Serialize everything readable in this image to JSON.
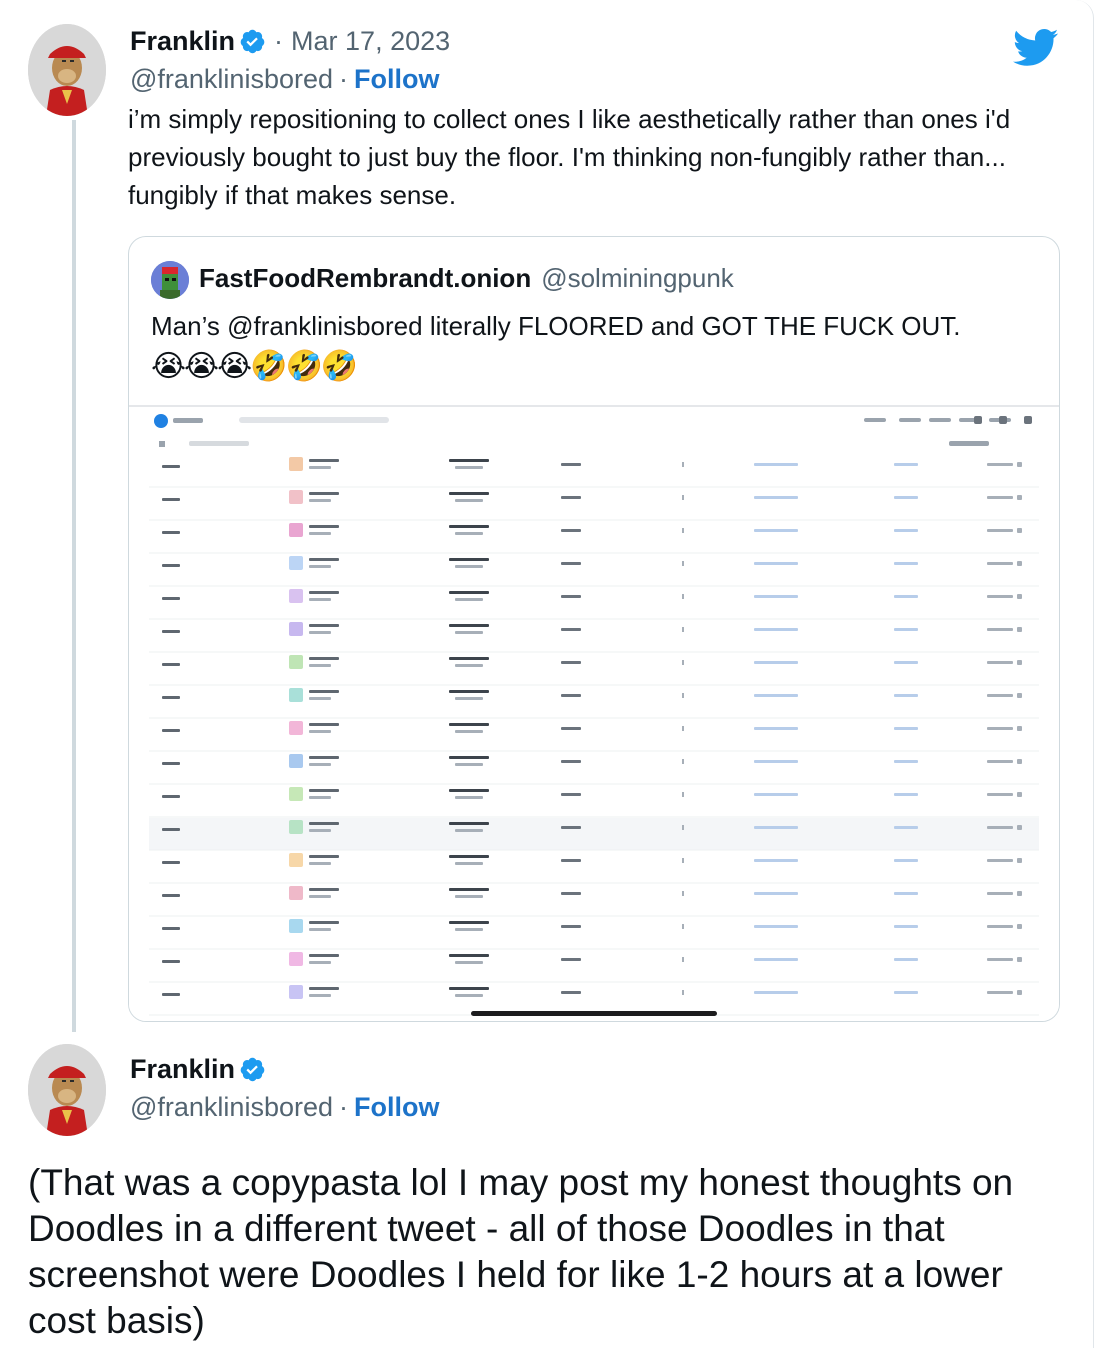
{
  "tweet1": {
    "display_name": "Franklin",
    "verified_icon": "verified-badge-icon",
    "date": "Mar 17, 2023",
    "handle": "@franklinisbored",
    "follow_label": "Follow",
    "text": "i’m simply repositioning to collect ones I like aesthetically rather than ones i'd previously bought to just buy the floor. I'm thinking non-fungibly rather than... fungibly if that makes sense."
  },
  "quote": {
    "display_name": "FastFoodRembrandt.onion",
    "handle": "@solminingpunk",
    "text": "Man’s @franklinisbored literally FLOORED and GOT THE FUCK OUT.",
    "emoji": "😭😭😭🤣🤣🤣"
  },
  "tweet2": {
    "display_name": "Franklin",
    "handle": "@franklinisbored",
    "follow_label": "Follow",
    "text": "(That was a copypasta lol I may post my honest thoughts on Doodles in a different tweet - all of those Doodles in that screenshot were Doodles I held for like 1-2 hours at a lower cost basis)"
  },
  "colors": {
    "follow": "#1d73c9",
    "twitter_blue": "#1d9bf0",
    "muted_text": "#536471",
    "thread_line": "#cfd9de"
  },
  "icons": [
    "twitter-bird-icon",
    "verified-badge-icon"
  ]
}
